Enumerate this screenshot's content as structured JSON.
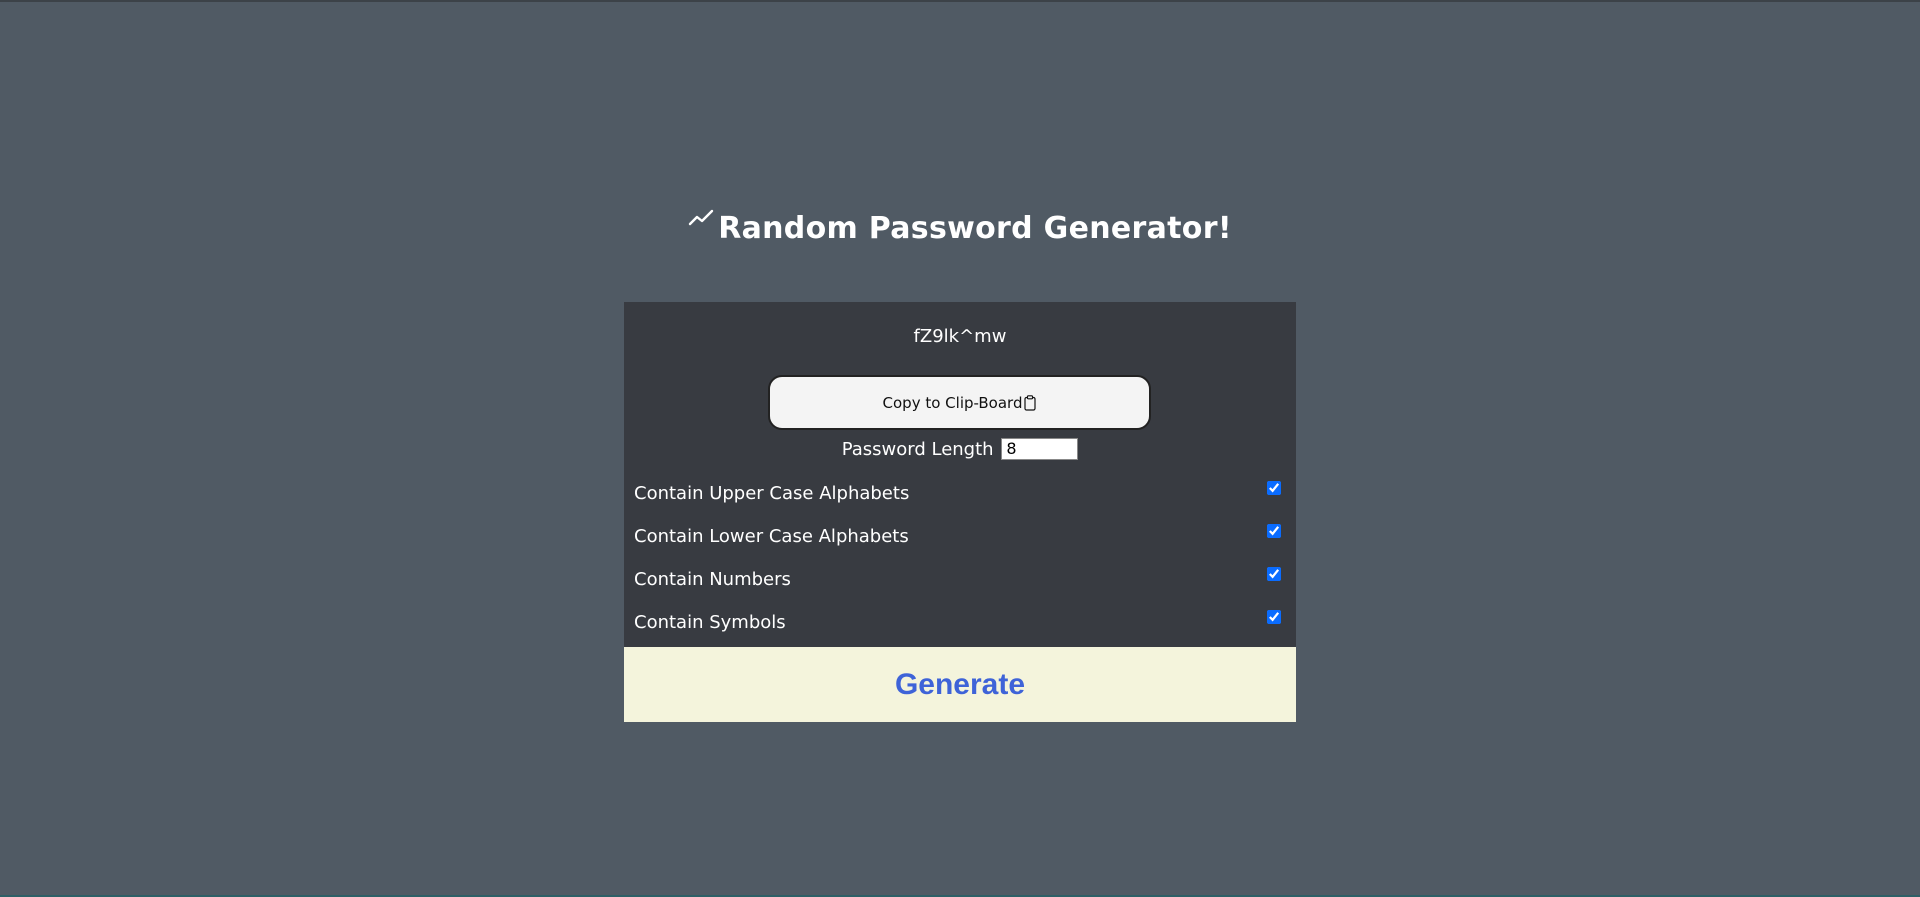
{
  "title": "Random Password Generator!",
  "password": "fZ9lk^mw",
  "copy_button": {
    "label": "Copy to Clip-Board"
  },
  "length": {
    "label": "Password Length",
    "value": "8"
  },
  "options": [
    {
      "label": "Contain Upper Case Alphabets",
      "checked": true
    },
    {
      "label": "Contain Lower Case Alphabets",
      "checked": true
    },
    {
      "label": "Contain Numbers",
      "checked": true
    },
    {
      "label": "Contain Symbols",
      "checked": true
    }
  ],
  "generate_button": {
    "label": "Generate"
  },
  "colors": {
    "background": "#505a64",
    "card": "#383b41",
    "generate_bg": "#f4f4dc",
    "generate_text": "#3e63d8",
    "checkbox": "#0a6cff"
  },
  "icons": {
    "title": "chart-line-icon",
    "copy": "clipboard-icon"
  }
}
